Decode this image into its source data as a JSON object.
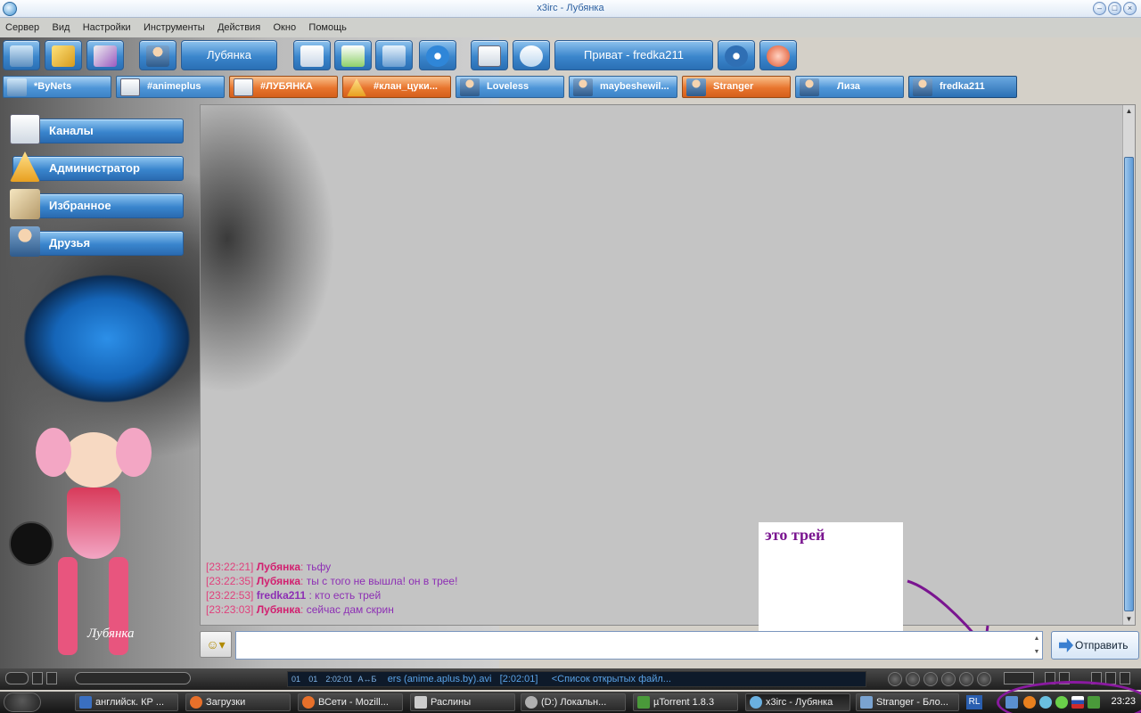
{
  "window": {
    "title": "x3irc - Лубянка",
    "controls": [
      "minimize",
      "maximize",
      "close"
    ]
  },
  "menu": [
    "Сервер",
    "Вид",
    "Настройки",
    "Инструменты",
    "Действия",
    "Окно",
    "Помощь"
  ],
  "toolbar": {
    "nick_label": "Лубянка",
    "private_label": "Приват - fredka211"
  },
  "tabs": [
    {
      "label": "*ByNets",
      "style": "blue",
      "icon": "network-icon"
    },
    {
      "label": "#animeplus",
      "style": "blue",
      "icon": "document-icon"
    },
    {
      "label": "#ЛУБЯНКА",
      "style": "orange",
      "icon": "document-icon"
    },
    {
      "label": "#клан_цуки...",
      "style": "orange",
      "icon": "warning-icon"
    },
    {
      "label": "Loveless",
      "style": "blue",
      "icon": "person-icon"
    },
    {
      "label": "maybeshewil...",
      "style": "blue",
      "icon": "person-icon"
    },
    {
      "label": "Stranger",
      "style": "orange",
      "icon": "person-icon"
    },
    {
      "label": "Лиза",
      "style": "blue",
      "icon": "person-icon"
    },
    {
      "label": "fredka211",
      "style": "active",
      "icon": "person-icon"
    }
  ],
  "sidebar": {
    "items": [
      {
        "label": "Каналы",
        "icon": "channels-icon"
      },
      {
        "label": "Администратор",
        "icon": "warning-icon"
      },
      {
        "label": "Избранное",
        "icon": "favorites-icon"
      },
      {
        "label": "Друзья",
        "icon": "friends-icon"
      }
    ],
    "watermark": "Лубянка"
  },
  "chat": {
    "messages": [
      {
        "time": "[23:22:21]",
        "nick": "Лубянка",
        "sep": ":",
        "text": " тьфу",
        "nick_color": "pink"
      },
      {
        "time": "[23:22:35]",
        "nick": "Лубянка",
        "sep": ":",
        "text": " ты с того не вышла! он в трее!",
        "nick_color": "pink"
      },
      {
        "time": "[23:22:53]",
        "nick": "fredka211",
        "sep": " :",
        "text": " кто есть трей",
        "nick_color": "purple"
      },
      {
        "time": "[23:23:03]",
        "nick": "Лубянка",
        "sep": ":",
        "text": " сейчас дам скрин",
        "nick_color": "pink"
      }
    ],
    "input_value": "",
    "send_label": "Отправить"
  },
  "annotation": {
    "note_text": "это трей"
  },
  "player": {
    "counter_a": "01",
    "counter_b": "01",
    "time": "2:02:01",
    "mode": "A↔Б",
    "track_text": "ers (anime.aplus.by).avi",
    "track_time": "[2:02:01]",
    "playlist_text": "<Список открытых файл..."
  },
  "taskbar": {
    "items": [
      {
        "label": "английск. КР ...",
        "icon": "word-icon"
      },
      {
        "label": "Загрузки",
        "icon": "firefox-icon"
      },
      {
        "label": "ВСети - Mozill...",
        "icon": "firefox-icon"
      },
      {
        "label": "Раслины",
        "icon": "folder-icon"
      },
      {
        "label": "(D:) Локальн...",
        "icon": "drive-icon"
      },
      {
        "label": "µTorrent 1.8.3",
        "icon": "utorrent-icon"
      },
      {
        "label": "x3irc - Лубянка",
        "icon": "irc-icon"
      },
      {
        "label": "Stranger - Бло...",
        "icon": "document-icon"
      }
    ],
    "language": "RL",
    "clock": "23:23"
  },
  "colors": {
    "accent_blue": "#3b86cc",
    "accent_orange": "#e8752e",
    "nick_pink": "#d21f6f",
    "nick_purple": "#8d2fb4",
    "annotation_purple": "#7a1590"
  }
}
